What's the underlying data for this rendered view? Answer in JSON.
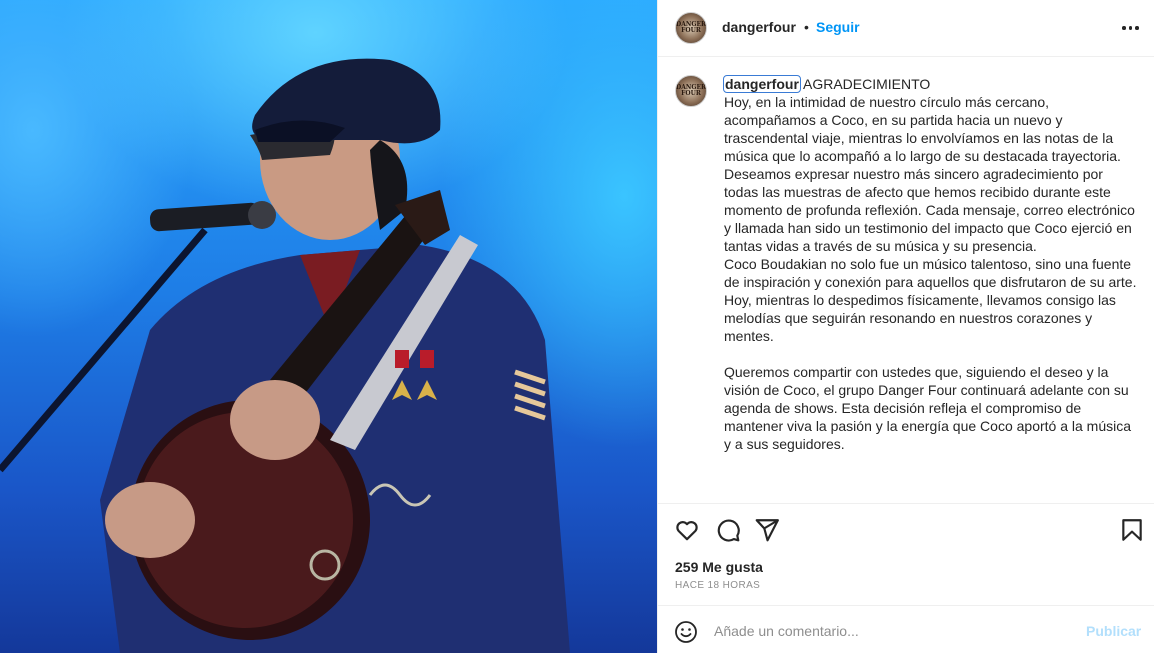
{
  "post": {
    "author": "dangerfour",
    "avatar_text": "DANGER FOUR",
    "separator": "•",
    "follow_label": "Seguir",
    "caption_title": " AGRADECIMIENTO",
    "caption_body": "Hoy, en la intimidad de nuestro círculo más cercano, acompañamos a Coco, en su partida hacia un nuevo y trascendental viaje, mientras lo envolvíamos en las notas de la música que lo acompañó a lo largo de su destacada trayectoria.\nDeseamos expresar nuestro más sincero agradecimiento por todas las muestras de afecto que hemos recibido durante este momento de profunda reflexión. Cada mensaje, correo electrónico y llamada han sido un testimonio del impacto que Coco ejerció en tantas vidas a través de su música y su presencia.\nCoco Boudakian no solo fue un músico talentoso, sino una fuente de inspiración y conexión para aquellos que disfrutaron de su arte. Hoy, mientras lo despedimos físicamente, llevamos consigo las melodías que seguirán resonando en nuestros corazones y mentes.\n\nQueremos compartir con ustedes que, siguiendo el deseo y la visión de Coco, el grupo Danger Four continuará adelante con su agenda de shows. Esta decisión refleja el compromiso de mantener viva la pasión y la energía que Coco aportó a la música y a sus seguidores.",
    "likes": "259 Me gusta",
    "time": "HACE 18 HORAS"
  },
  "icons": {
    "like": "heart-icon",
    "comment": "comment-icon",
    "share": "send-icon",
    "save": "bookmark-icon",
    "more": "more-icon",
    "emoji": "emoji-icon"
  },
  "comment_box": {
    "placeholder": "Añade un comentario...",
    "publish_label": "Publicar"
  },
  "colors": {
    "accent": "#0095f6",
    "publish_disabled": "#b2dffc",
    "muted": "#8e8e8e",
    "text": "#262626"
  }
}
